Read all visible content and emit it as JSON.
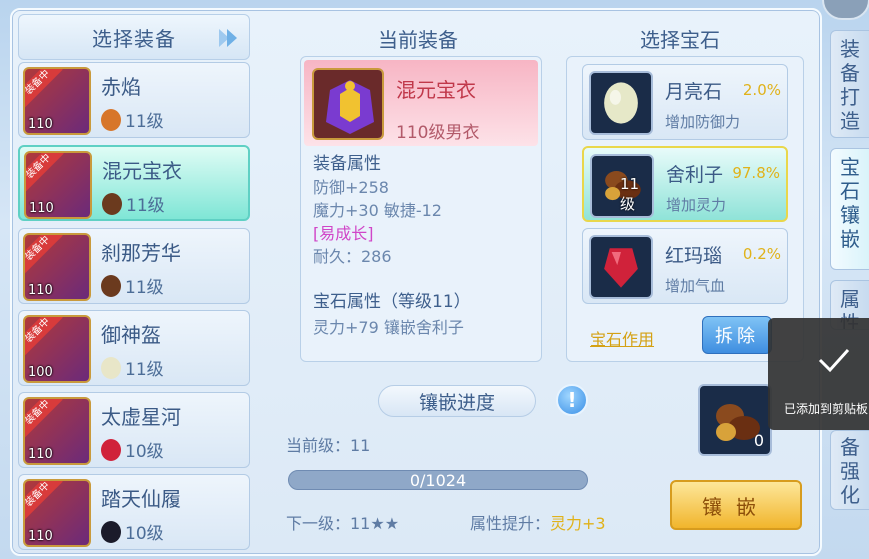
{
  "left": {
    "header": "选择装备",
    "items": [
      {
        "name": "赤焰",
        "level": "110",
        "gem_level": "11级",
        "tag": "装备中",
        "gem_color": "#d7762a"
      },
      {
        "name": "混元宝衣",
        "level": "110",
        "gem_level": "11级",
        "tag": "装备中",
        "gem_color": "#6b3a1e"
      },
      {
        "name": "刹那芳华",
        "level": "110",
        "gem_level": "11级",
        "tag": "装备中",
        "gem_color": "#6b3a1e"
      },
      {
        "name": "御神盔",
        "level": "100",
        "gem_level": "11级",
        "tag": "装备中",
        "gem_color": "#e8e6c8"
      },
      {
        "name": "太虚星河",
        "level": "110",
        "gem_level": "10级",
        "tag": "装备中",
        "gem_color": "#d0223a"
      },
      {
        "name": "踏天仙履",
        "level": "110",
        "gem_level": "10级",
        "tag": "装备中",
        "gem_color": "#1b1b2a"
      }
    ]
  },
  "middle": {
    "title": "当前装备",
    "equip_name": "混元宝衣",
    "equip_sub": "110级男衣",
    "attr_header": "装备属性",
    "attr_lines": [
      "防御+258",
      "魔力+30 敏捷-12",
      "[易成长]",
      "耐久：286"
    ],
    "gem_header": "宝石属性（等级11）",
    "gem_line": "灵力+79 镶嵌舍利子",
    "progress_title": "镶嵌进度",
    "current_level": "当前级：11",
    "progress_text": "0/1024",
    "next_level": "下一级：11★★",
    "boost_label": "属性提升：",
    "boost_value": "灵力+3"
  },
  "right": {
    "title": "选择宝石",
    "gems": [
      {
        "name": "月亮石",
        "pct": "2.0%",
        "desc": "增加防御力",
        "level": ""
      },
      {
        "name": "舍利子",
        "pct": "97.8%",
        "desc": "增加灵力",
        "level": "11级"
      },
      {
        "name": "红玛瑙",
        "pct": "0.2%",
        "desc": "增加气血",
        "level": ""
      }
    ],
    "gem_effect": "宝石作用",
    "remove": "拆除",
    "slot_count": "0",
    "inlay": "镶嵌"
  },
  "tabs": [
    "装备打造",
    "宝石镶嵌",
    "属性",
    "备强化"
  ],
  "toast": "已添加到剪贴板"
}
